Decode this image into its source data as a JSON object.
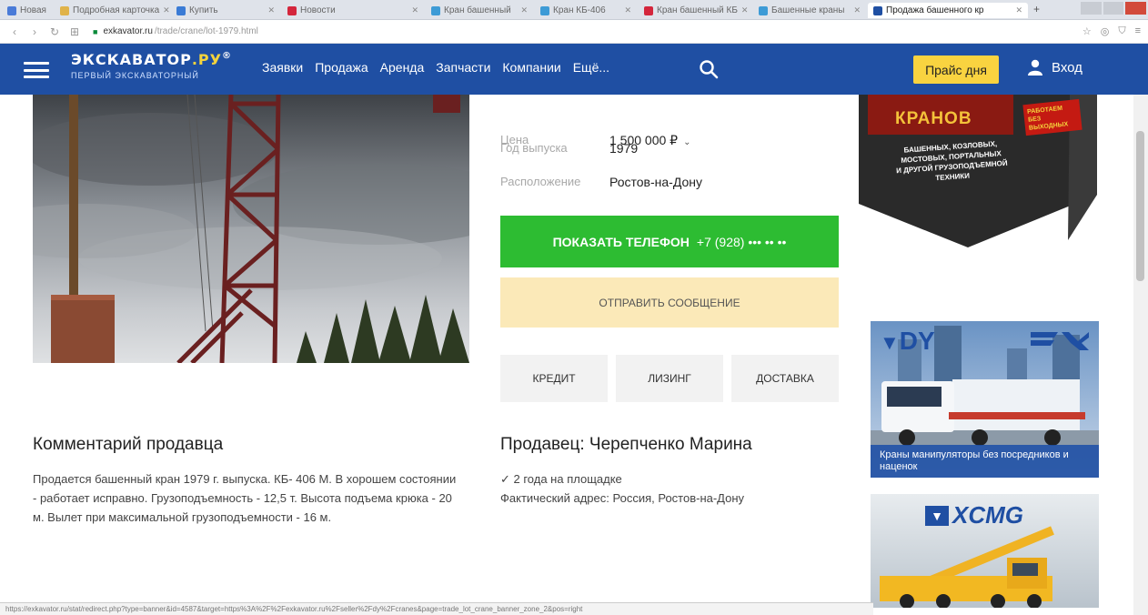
{
  "browser": {
    "tabs": [
      {
        "label": "Новая",
        "color": "#4a7bd8"
      },
      {
        "label": "Подробная карточка",
        "color": "#e0b34a"
      },
      {
        "label": "Купить",
        "color": "#3a7bd5"
      },
      {
        "label": "Новости",
        "color": "#d4263c"
      },
      {
        "label": "Кран башенный",
        "color": "#3d9bd6"
      },
      {
        "label": "Кран КБ-406",
        "color": "#3d9bd6"
      },
      {
        "label": "Кран башенный КБ",
        "color": "#d4263c"
      },
      {
        "label": "Башенные краны",
        "color": "#3d9bd6"
      },
      {
        "label": "Продажа башенного кр",
        "color": "#1f4fa3"
      }
    ],
    "new_tab": "+",
    "url_host": "exkavator.ru",
    "url_path": "/trade/crane/lot-1979.html",
    "status_text": "https://exkavator.ru/stat/redirect.php?type=banner&id=4587&target=https%3A%2F%2Fexkavator.ru%2Fseller%2Fdy%2Fcranes&page=trade_lot_crane_banner_zone_2&pos=right"
  },
  "header": {
    "logo_main": "ЭКСКАВАТОР",
    "logo_ru": ".РУ",
    "logo_reg": "®",
    "logo_sub": "ПЕРВЫЙ ЭКСКАВАТОРНЫЙ",
    "nav": [
      "Заявки",
      "Продажа",
      "Аренда",
      "Запчасти",
      "Компании",
      "Ещё..."
    ],
    "price_btn": "Прайс дня",
    "login": "Вход",
    "brand_color": "#1f4fa3"
  },
  "listing": {
    "price_label": "Цена",
    "price_value": "1 500 000 ₽",
    "price_chevron": "⌄",
    "year_label": "Год выпуска",
    "year_value": "1979",
    "location_label": "Расположение",
    "location_value": "Ростов-на-Дону",
    "show_phone_label": "ПОКАЗАТЬ ТЕЛЕФОН",
    "phone_masked": "+7 (928) ••• •• ••",
    "send_message_label": "ОТПРАВИТЬ СООБЩЕНИЕ",
    "credit_label": "КРЕДИТ",
    "leasing_label": "ЛИЗИНГ",
    "delivery_label": "ДОСТАВКА"
  },
  "comment": {
    "title": "Комментарий продавца",
    "text": "Продается башенный кран 1979 г. выпуска. КБ- 406 М. В хорошем состоянии - работает исправно. Грузоподъемность - 12,5 т. Высота подъема крюка - 20 м. Вылет при максимальной грузоподъемности - 16 м."
  },
  "seller": {
    "title": "Продавец: Черепченко Марина",
    "tenure": "✓ 2 года на площадке",
    "address": "Фактический адрес: Россия, Ростов-на-Дону"
  },
  "ads": {
    "top_title": "КРАНОВ",
    "top_badge": "РАБОТАЕМ БЕЗ ВЫХОДНЫХ",
    "top_text_1": "БАШЕННЫХ, КОЗЛОВЫХ,",
    "top_text_2": "МОСТОВЫХ, ПОРТАЛЬНЫХ",
    "top_text_3": "И ДРУГОЙ ГРУЗОПОДЪЕМНОЙ",
    "top_text_4": "ТЕХНИКИ",
    "dy_logo": "DY",
    "dy_caption": "Краны манипуляторы без посредников и наценок",
    "xcmg_logo": "XCMG"
  }
}
